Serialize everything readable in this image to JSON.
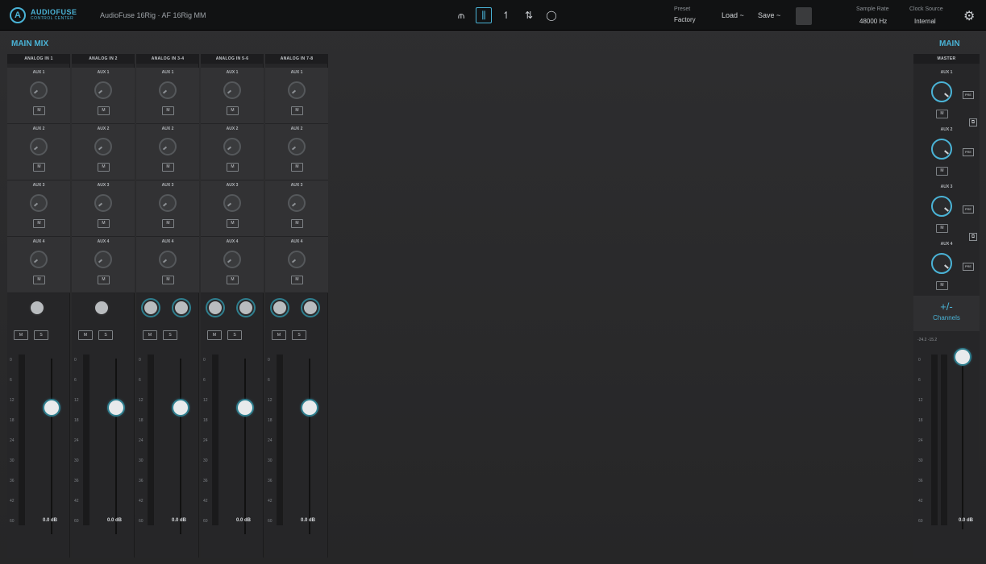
{
  "topbar": {
    "logo_line1": "AUDIOFUSE",
    "logo_line2": "CONTROL CENTER",
    "device": "AudioFuse 16Rig · AF 16Rig MM",
    "preset_label": "Preset",
    "preset_value": "Factory",
    "load_label": "Load ~",
    "save_label": "Save ~",
    "sample_rate_label": "Sample Rate",
    "sample_rate_value": "48000 Hz",
    "clock_source_label": "Clock Source",
    "clock_source_value": "Internal",
    "nav_icons": [
      "io-icon",
      "mixer-icon",
      "routing-icon",
      "patch-icon",
      "loop-icon"
    ]
  },
  "main_mix": {
    "title": "MAIN MIX",
    "aux_labels": [
      "AUX 1",
      "AUX 2",
      "AUX 3",
      "AUX 4"
    ],
    "mute_label": "M",
    "solo_label": "S",
    "channels": [
      {
        "name": "ANALOG IN 1",
        "db": "0.0 dB",
        "stereo": false,
        "fader_level": 0.72
      },
      {
        "name": "ANALOG IN 2",
        "db": "0.0 dB",
        "stereo": false,
        "fader_level": 0.72
      },
      {
        "name": "ANALOG IN 3-4",
        "db": "0.0 dB",
        "stereo": true,
        "fader_level": 0.72
      },
      {
        "name": "ANALOG IN 5-6",
        "db": "0.0 dB",
        "stereo": true,
        "fader_level": 0.72
      },
      {
        "name": "ANALOG IN 7-8",
        "db": "0.0 dB",
        "stereo": true,
        "fader_level": 0.72
      }
    ],
    "scale": [
      "0",
      "6",
      "12",
      "18",
      "24",
      "30",
      "36",
      "42",
      "60"
    ]
  },
  "main": {
    "title": "MAIN",
    "master_label": "MASTER",
    "aux_labels": [
      "AUX 1",
      "AUX 2",
      "AUX 3",
      "AUX 4"
    ],
    "mute_label": "M",
    "pre_label": "PRE",
    "plus_minus": "+/-",
    "channels_label": "Channels",
    "peak_label": "-24.2 -15.2",
    "db": "0.0 dB",
    "fader_level": 1.0
  },
  "colors": {
    "accent": "#4ab3d6"
  }
}
